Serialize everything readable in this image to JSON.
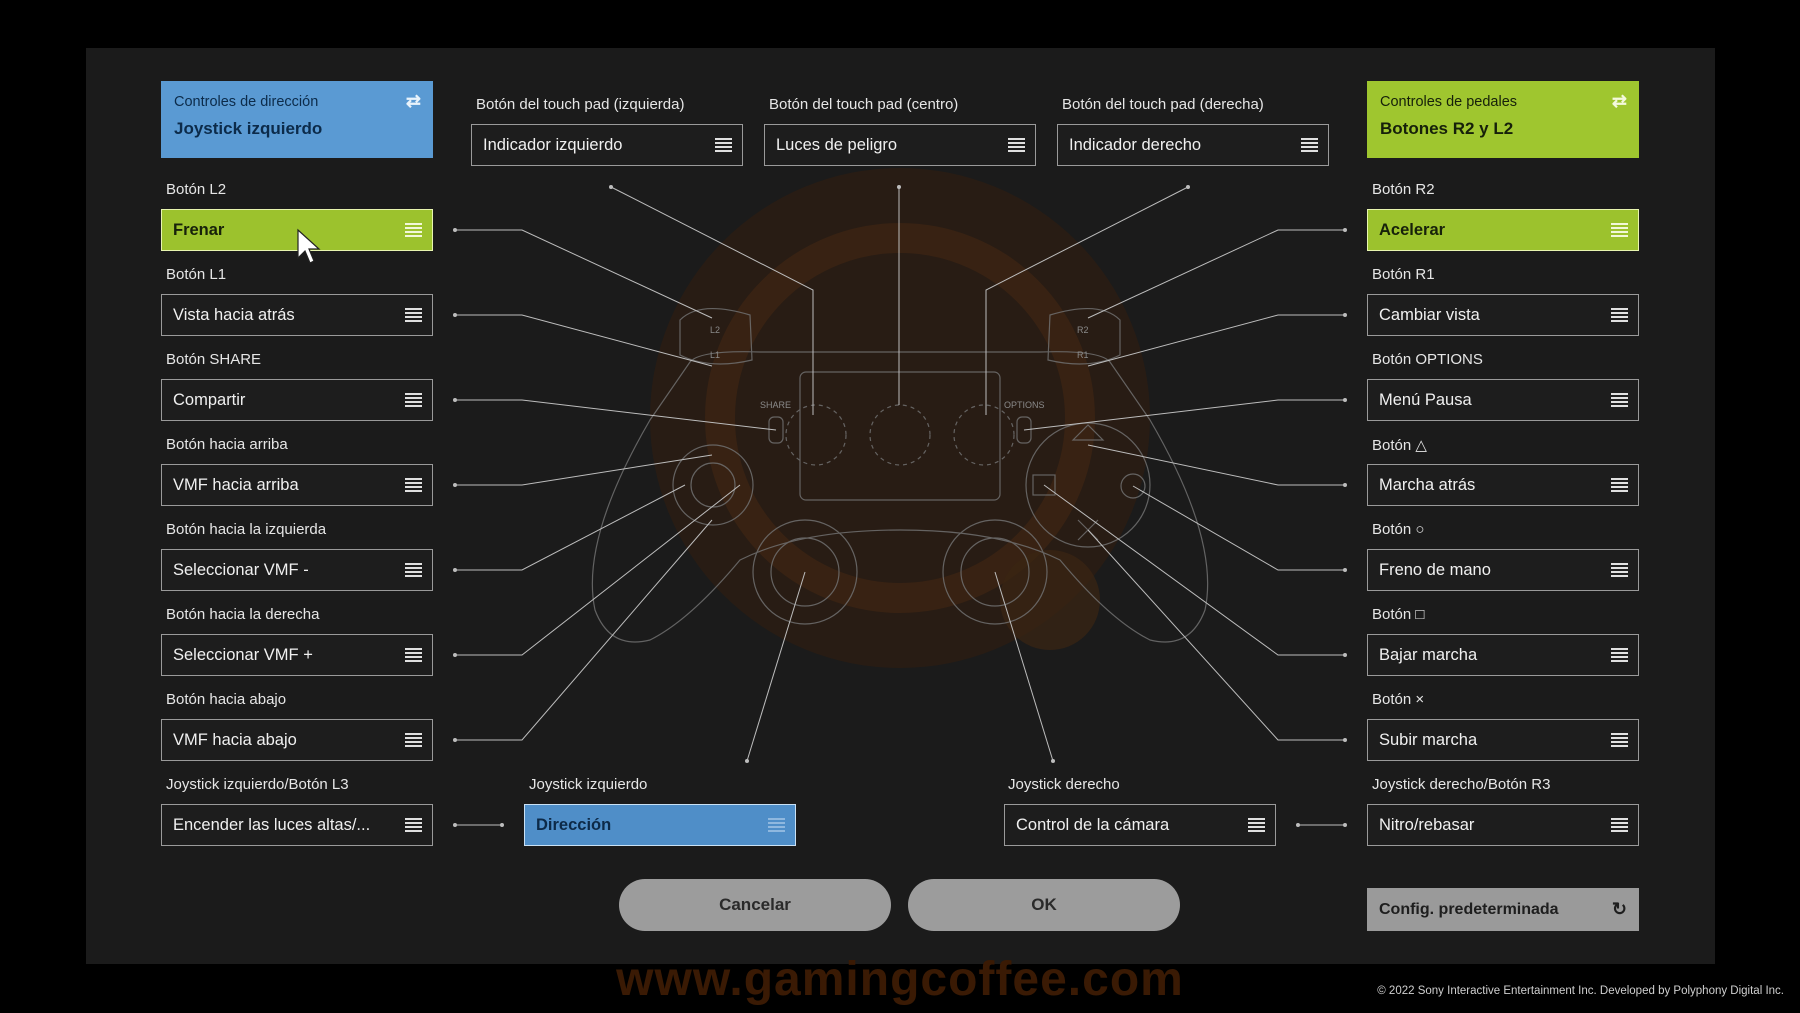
{
  "steering": {
    "title": "Controles de dirección",
    "value": "Joystick izquierdo"
  },
  "pedals": {
    "title": "Controles de pedales",
    "value": "Botones R2 y L2"
  },
  "touchpad": {
    "left": {
      "label": "Botón del touch pad (izquierda)",
      "value": "Indicador izquierdo"
    },
    "center": {
      "label": "Botón del touch pad (centro)",
      "value": "Luces de peligro"
    },
    "right": {
      "label": "Botón del touch pad (derecha)",
      "value": "Indicador derecho"
    }
  },
  "left_column": [
    {
      "label": "Botón L2",
      "value": "Frenar"
    },
    {
      "label": "Botón L1",
      "value": "Vista hacia atrás"
    },
    {
      "label": "Botón SHARE",
      "value": "Compartir"
    },
    {
      "label": "Botón hacia arriba",
      "value": "VMF hacia arriba"
    },
    {
      "label": "Botón hacia la izquierda",
      "value": "Seleccionar VMF -"
    },
    {
      "label": "Botón hacia la derecha",
      "value": "Seleccionar VMF +"
    },
    {
      "label": "Botón hacia abajo",
      "value": "VMF hacia abajo"
    },
    {
      "label": "Joystick izquierdo/Botón L3",
      "value": "Encender las luces altas/..."
    }
  ],
  "right_column": [
    {
      "label": "Botón R2",
      "value": "Acelerar"
    },
    {
      "label": "Botón R1",
      "value": "Cambiar vista"
    },
    {
      "label": "Botón OPTIONS",
      "value": "Menú Pausa"
    },
    {
      "label": "Botón △",
      "value": "Marcha atrás"
    },
    {
      "label": "Botón ○",
      "value": "Freno de mano"
    },
    {
      "label": "Botón □",
      "value": "Bajar marcha"
    },
    {
      "label": "Botón ×",
      "value": "Subir marcha"
    },
    {
      "label": "Joystick derecho/Botón R3",
      "value": "Nitro/rebasar"
    }
  ],
  "left_stick": {
    "label": "Joystick izquierdo",
    "value": "Dirección"
  },
  "right_stick": {
    "label": "Joystick derecho",
    "value": "Control de la cámara"
  },
  "buttons": {
    "cancel": "Cancelar",
    "ok": "OK",
    "default": "Config. predeterminada"
  },
  "controller_labels": {
    "share": "SHARE",
    "options": "OPTIONS",
    "l2": "L2",
    "l1": "L1",
    "r2": "R2",
    "r1": "R1"
  },
  "watermark": "www.gamingcoffee.com",
  "copyright": "© 2022 Sony Interactive Entertainment Inc. Developed by Polyphony Digital Inc.",
  "colors": {
    "green": "#9fc62f",
    "blue": "#5a9ad3",
    "panel": "#1b1b1b",
    "field_border": "#9a9a9a"
  }
}
